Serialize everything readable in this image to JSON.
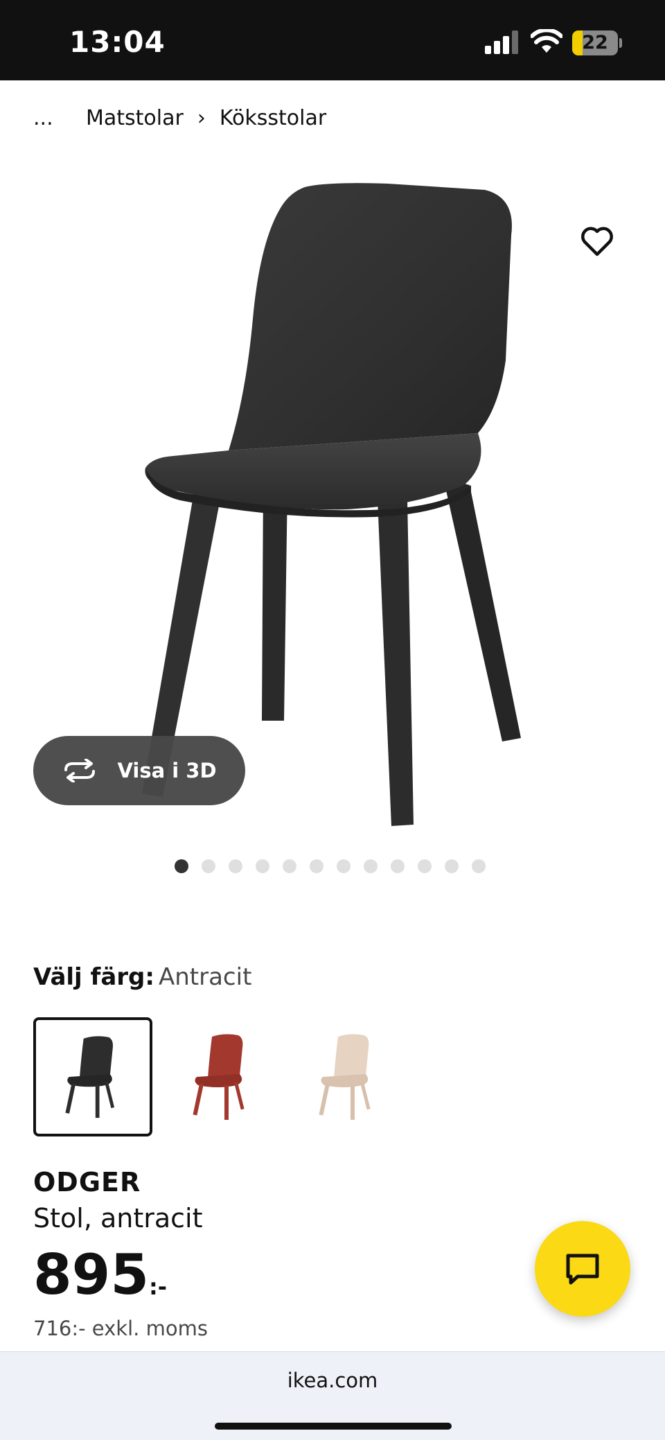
{
  "status_bar": {
    "time": "13:04",
    "battery_level": "22",
    "battery_fill_fraction": 0.22,
    "icons": [
      "cellular-signal-icon",
      "wifi-icon",
      "battery-charging-icon"
    ]
  },
  "breadcrumb": {
    "ellipsis": "...",
    "items": [
      "Matstolar",
      "Köksstolar"
    ],
    "separator": "›"
  },
  "product_image": {
    "favorite_icon": "heart-icon",
    "view_3d": {
      "label": "Visa i 3D",
      "icon": "rotate-arrows-icon"
    },
    "carousel": {
      "total": 12,
      "active_index": 0
    }
  },
  "color": {
    "label": "Välj färg:",
    "selected": "Antracit",
    "swatches": [
      {
        "color": "#2d2d2d",
        "selected": true
      },
      {
        "color": "#a3382e",
        "selected": false
      },
      {
        "color": "#e3cfbd",
        "selected": false
      }
    ]
  },
  "product": {
    "name": "ODGER",
    "description": "Stol, antracit",
    "price": "895",
    "price_suffix": ":-",
    "price_excl_vat": "716:- exkl. moms"
  },
  "chat": {
    "icon": "chat-bubble-icon",
    "color": "#fbd914"
  },
  "browser": {
    "url": "ikea.com"
  }
}
